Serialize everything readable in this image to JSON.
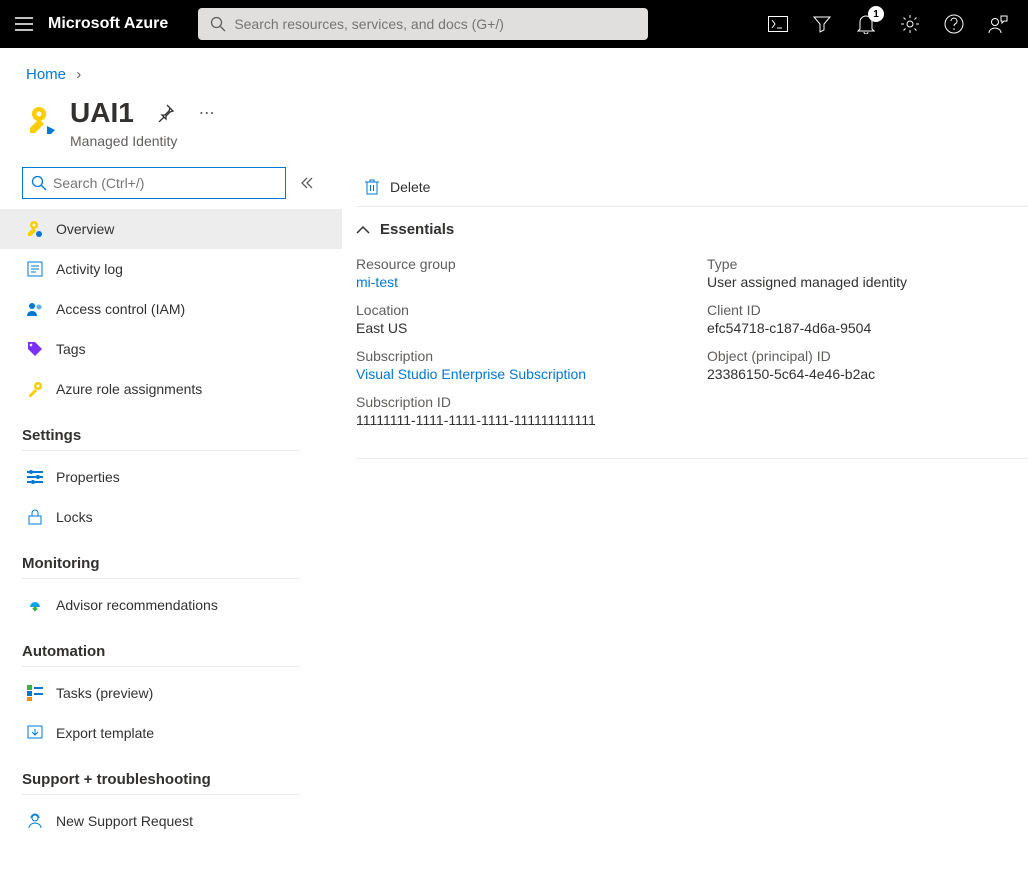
{
  "topbar": {
    "brand": "Microsoft Azure",
    "search_placeholder": "Search resources, services, and docs (G+/)",
    "notification_count": "1"
  },
  "breadcrumb": {
    "home": "Home"
  },
  "header": {
    "title": "UAI1",
    "subtitle": "Managed Identity"
  },
  "sidebar": {
    "search_placeholder": "Search (Ctrl+/)",
    "items_top": [
      {
        "label": "Overview"
      },
      {
        "label": "Activity log"
      },
      {
        "label": "Access control (IAM)"
      },
      {
        "label": "Tags"
      },
      {
        "label": "Azure role assignments"
      }
    ],
    "sections": [
      {
        "label": "Settings",
        "items": [
          {
            "label": "Properties"
          },
          {
            "label": "Locks"
          }
        ]
      },
      {
        "label": "Monitoring",
        "items": [
          {
            "label": "Advisor recommendations"
          }
        ]
      },
      {
        "label": "Automation",
        "items": [
          {
            "label": "Tasks (preview)"
          },
          {
            "label": "Export template"
          }
        ]
      },
      {
        "label": "Support + troubleshooting",
        "items": [
          {
            "label": "New Support Request"
          }
        ]
      }
    ]
  },
  "toolbar": {
    "delete": "Delete"
  },
  "essentials": {
    "heading": "Essentials",
    "left": [
      {
        "label": "Resource group",
        "value": "mi-test",
        "link": true
      },
      {
        "label": "Location",
        "value": "East US"
      },
      {
        "label": "Subscription",
        "value": "Visual Studio Enterprise Subscription",
        "link": true
      },
      {
        "label": "Subscription ID",
        "value": "11111111-1111-1111-1111-111111111111"
      }
    ],
    "right": [
      {
        "label": "Type",
        "value": "User assigned managed identity"
      },
      {
        "label": "Client ID",
        "value": "efc54718-c187-4d6a-9504"
      },
      {
        "label": "Object (principal) ID",
        "value": "23386150-5c64-4e46-b2ac"
      }
    ]
  }
}
